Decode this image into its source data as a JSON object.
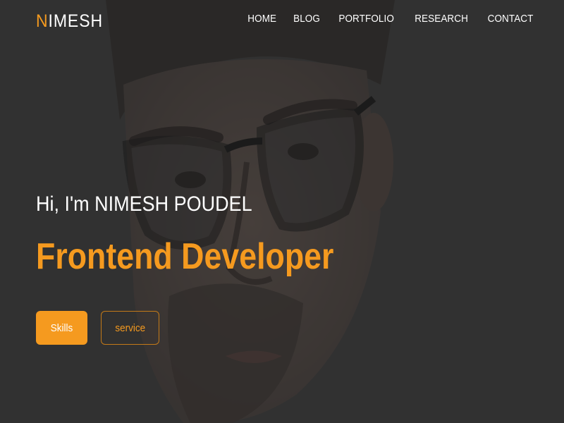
{
  "brand": {
    "accent_letter": "N",
    "rest": "IMESH",
    "accent_color": "#f59a1f"
  },
  "nav": {
    "items": [
      {
        "label": "HOME"
      },
      {
        "label": "BLOG"
      },
      {
        "label": "PORTFOLIO"
      },
      {
        "label": "RESEARCH"
      },
      {
        "label": "CONTACT"
      }
    ]
  },
  "hero": {
    "greeting": "Hi, I'm NIMESH POUDEL",
    "role": "Frontend Developer",
    "background": "portrait-photo"
  },
  "buttons": {
    "skills_label": "Skills",
    "service_label": "service"
  }
}
